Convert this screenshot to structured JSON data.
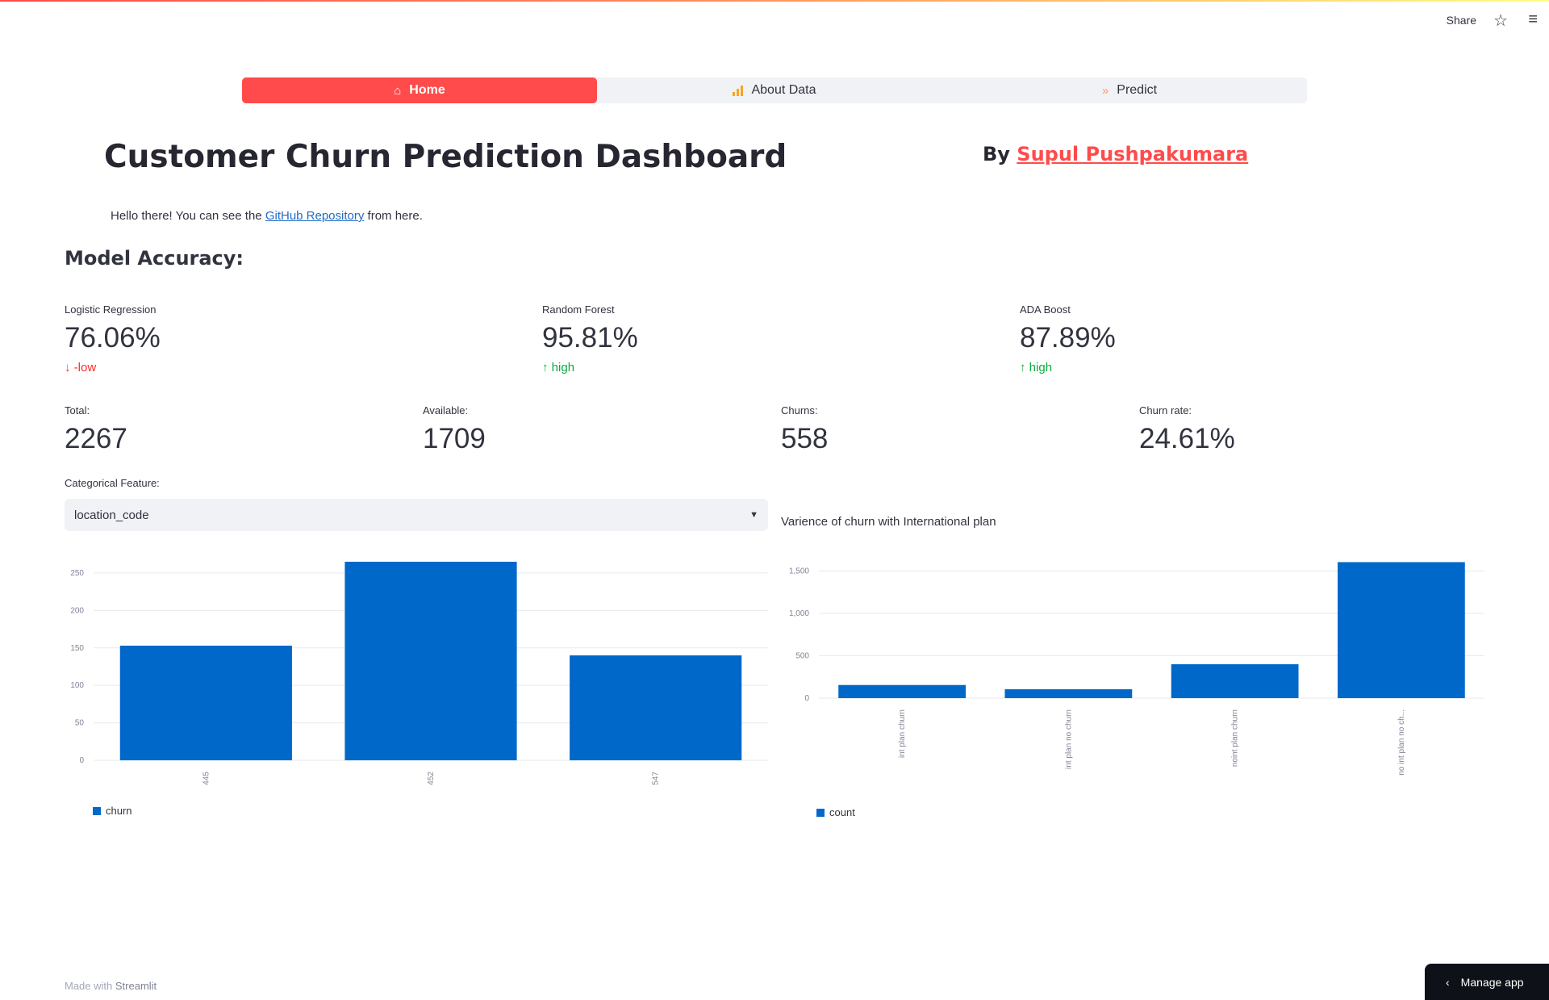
{
  "toolbar": {
    "share_label": "Share",
    "star_icon": "star-icon",
    "menu_icon": "hamburger-menu-icon"
  },
  "nav": {
    "items": [
      {
        "label": "Home",
        "icon": "home-icon",
        "active": true
      },
      {
        "label": "About Data",
        "icon": "bar-chart-icon",
        "active": false
      },
      {
        "label": "Predict",
        "icon": "chevron-double-right-icon",
        "active": false
      }
    ]
  },
  "header": {
    "title": "Customer Churn Prediction Dashboard",
    "by_prefix": "By",
    "author": "Supul Pushpakumara",
    "hello_prefix": "Hello there! You can see the",
    "repo_link": "GitHub Repository",
    "hello_suffix": "from here."
  },
  "accuracy": {
    "heading": "Model Accuracy:",
    "metrics": [
      {
        "label": "Logistic Regression",
        "value": "76.06%",
        "delta": "-low",
        "direction": "down"
      },
      {
        "label": "Random Forest",
        "value": "95.81%",
        "delta": "high",
        "direction": "up"
      },
      {
        "label": "ADA Boost",
        "value": "87.89%",
        "delta": "high",
        "direction": "up"
      }
    ]
  },
  "stats": [
    {
      "label": "Total:",
      "value": "2267"
    },
    {
      "label": "Available:",
      "value": "1709"
    },
    {
      "label": "Churns:",
      "value": "558"
    },
    {
      "label": "Churn rate:",
      "value": "24.61%"
    }
  ],
  "selector": {
    "label": "Categorical Feature:",
    "value": "location_code"
  },
  "chart_data": [
    {
      "type": "bar",
      "title": "",
      "categories": [
        "445",
        "452",
        "547"
      ],
      "series": [
        {
          "name": "churn",
          "values": [
            153,
            265,
            140
          ]
        }
      ],
      "ylim": [
        0,
        265
      ],
      "yticks": [
        0,
        50,
        100,
        150,
        200,
        250
      ],
      "ytick_labels": [
        "0",
        "50",
        "100",
        "150",
        "200",
        "250"
      ],
      "grid": true,
      "legend": "bottom-left",
      "color": "#0068c9"
    },
    {
      "type": "bar",
      "title": "Varience of churn with International plan",
      "categories": [
        "int plan churn",
        "int plan no churn",
        "noint plan churn",
        "no int plan no ch..."
      ],
      "series": [
        {
          "name": "count",
          "values": [
            155,
            105,
            400,
            1605
          ]
        }
      ],
      "ylim": [
        0,
        1600
      ],
      "yticks": [
        0,
        500,
        1000,
        1500
      ],
      "ytick_labels": [
        "0",
        "500",
        "1,000",
        "1,500"
      ],
      "grid": true,
      "legend": "bottom-left",
      "color": "#0068c9"
    }
  ],
  "footer": {
    "prefix": "Made with",
    "brand": "Streamlit"
  },
  "manage": {
    "label": "Manage app",
    "icon": "chevron-left-icon"
  }
}
